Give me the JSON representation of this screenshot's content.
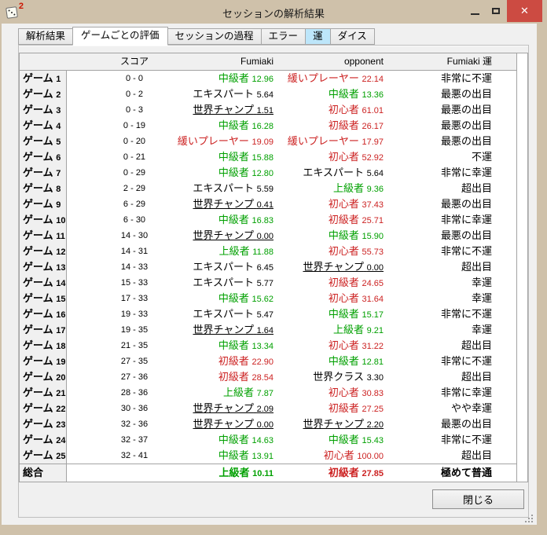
{
  "window": {
    "title": "セッションの解析結果",
    "icon_badge": "2",
    "controls": {
      "close": "✕"
    }
  },
  "tabs": [
    {
      "label": "解析結果",
      "active": false,
      "highlighted": false
    },
    {
      "label": "ゲームごとの評価",
      "active": true,
      "highlighted": false
    },
    {
      "label": "セッションの過程",
      "active": false,
      "highlighted": false
    },
    {
      "label": "エラー",
      "active": false,
      "highlighted": false
    },
    {
      "label": "運",
      "active": false,
      "highlighted": true
    },
    {
      "label": "ダイス",
      "active": false,
      "highlighted": false
    }
  ],
  "table": {
    "headers": {
      "score": "スコア",
      "player1": "Fumiaki",
      "player2": "opponent",
      "luck": "Fumiaki 運"
    },
    "rows": [
      {
        "game": {
          "label": "ゲーム",
          "num": "1"
        },
        "score": "0 - 0",
        "p1": {
          "text": "中級者",
          "num": "12.96",
          "color": "positive",
          "underline": false
        },
        "p2": {
          "text": "緩いプレーヤー",
          "num": "22.14",
          "color": "negative",
          "underline": false
        },
        "luck": "非常に不運"
      },
      {
        "game": {
          "label": "ゲーム",
          "num": "2"
        },
        "score": "0 - 2",
        "p1": {
          "text": "エキスパート",
          "num": "5.64",
          "color": "neutral",
          "underline": false
        },
        "p2": {
          "text": "中級者",
          "num": "13.36",
          "color": "positive",
          "underline": false
        },
        "luck": "最悪の出目"
      },
      {
        "game": {
          "label": "ゲーム",
          "num": "3"
        },
        "score": "0 - 3",
        "p1": {
          "text": "世界チャンプ",
          "num": "1.51",
          "color": "neutral",
          "underline": true
        },
        "p2": {
          "text": "初心者",
          "num": "61.01",
          "color": "negative",
          "underline": false
        },
        "luck": "最悪の出目"
      },
      {
        "game": {
          "label": "ゲーム",
          "num": "4"
        },
        "score": "0 - 19",
        "p1": {
          "text": "中級者",
          "num": "16.28",
          "color": "positive",
          "underline": false
        },
        "p2": {
          "text": "初級者",
          "num": "26.17",
          "color": "negative",
          "underline": false
        },
        "luck": "最悪の出目"
      },
      {
        "game": {
          "label": "ゲーム",
          "num": "5"
        },
        "score": "0 - 20",
        "p1": {
          "text": "緩いプレーヤー",
          "num": "19.09",
          "color": "negative",
          "underline": false
        },
        "p2": {
          "text": "緩いプレーヤー",
          "num": "17.97",
          "color": "negative",
          "underline": false
        },
        "luck": "最悪の出目"
      },
      {
        "game": {
          "label": "ゲーム",
          "num": "6"
        },
        "score": "0 - 21",
        "p1": {
          "text": "中級者",
          "num": "15.88",
          "color": "positive",
          "underline": false
        },
        "p2": {
          "text": "初心者",
          "num": "52.92",
          "color": "negative",
          "underline": false
        },
        "luck": "不運"
      },
      {
        "game": {
          "label": "ゲーム",
          "num": "7"
        },
        "score": "0 - 29",
        "p1": {
          "text": "中級者",
          "num": "12.80",
          "color": "positive",
          "underline": false
        },
        "p2": {
          "text": "エキスパート",
          "num": "5.64",
          "color": "neutral",
          "underline": false
        },
        "luck": "非常に幸運"
      },
      {
        "game": {
          "label": "ゲーム",
          "num": "8"
        },
        "score": "2 - 29",
        "p1": {
          "text": "エキスパート",
          "num": "5.59",
          "color": "neutral",
          "underline": false
        },
        "p2": {
          "text": "上級者",
          "num": "9.36",
          "color": "positive",
          "underline": false
        },
        "luck": "超出目"
      },
      {
        "game": {
          "label": "ゲーム",
          "num": "9"
        },
        "score": "6 - 29",
        "p1": {
          "text": "世界チャンプ",
          "num": "0.41",
          "color": "neutral",
          "underline": true
        },
        "p2": {
          "text": "初心者",
          "num": "37.43",
          "color": "negative",
          "underline": false
        },
        "luck": "最悪の出目"
      },
      {
        "game": {
          "label": "ゲーム",
          "num": "10"
        },
        "score": "6 - 30",
        "p1": {
          "text": "中級者",
          "num": "16.83",
          "color": "positive",
          "underline": false
        },
        "p2": {
          "text": "初級者",
          "num": "25.71",
          "color": "negative",
          "underline": false
        },
        "luck": "非常に幸運"
      },
      {
        "game": {
          "label": "ゲーム",
          "num": "11"
        },
        "score": "14 - 30",
        "p1": {
          "text": "世界チャンプ",
          "num": "0.00",
          "color": "neutral",
          "underline": true
        },
        "p2": {
          "text": "中級者",
          "num": "15.90",
          "color": "positive",
          "underline": false
        },
        "luck": "最悪の出目"
      },
      {
        "game": {
          "label": "ゲーム",
          "num": "12"
        },
        "score": "14 - 31",
        "p1": {
          "text": "上級者",
          "num": "11.88",
          "color": "positive",
          "underline": false
        },
        "p2": {
          "text": "初心者",
          "num": "55.73",
          "color": "negative",
          "underline": false
        },
        "luck": "非常に不運"
      },
      {
        "game": {
          "label": "ゲーム",
          "num": "13"
        },
        "score": "14 - 33",
        "p1": {
          "text": "エキスパート",
          "num": "6.45",
          "color": "neutral",
          "underline": false
        },
        "p2": {
          "text": "世界チャンプ",
          "num": "0.00",
          "color": "neutral",
          "underline": true
        },
        "luck": "超出目"
      },
      {
        "game": {
          "label": "ゲーム",
          "num": "14"
        },
        "score": "15 - 33",
        "p1": {
          "text": "エキスパート",
          "num": "5.77",
          "color": "neutral",
          "underline": false
        },
        "p2": {
          "text": "初級者",
          "num": "24.65",
          "color": "negative",
          "underline": false
        },
        "luck": "幸運"
      },
      {
        "game": {
          "label": "ゲーム",
          "num": "15"
        },
        "score": "17 - 33",
        "p1": {
          "text": "中級者",
          "num": "15.62",
          "color": "positive",
          "underline": false
        },
        "p2": {
          "text": "初心者",
          "num": "31.64",
          "color": "negative",
          "underline": false
        },
        "luck": "幸運"
      },
      {
        "game": {
          "label": "ゲーム",
          "num": "16"
        },
        "score": "19 - 33",
        "p1": {
          "text": "エキスパート",
          "num": "5.47",
          "color": "neutral",
          "underline": false
        },
        "p2": {
          "text": "中級者",
          "num": "15.17",
          "color": "positive",
          "underline": false
        },
        "luck": "非常に不運"
      },
      {
        "game": {
          "label": "ゲーム",
          "num": "17"
        },
        "score": "19 - 35",
        "p1": {
          "text": "世界チャンプ",
          "num": "1.64",
          "color": "neutral",
          "underline": true
        },
        "p2": {
          "text": "上級者",
          "num": "9.21",
          "color": "positive",
          "underline": false
        },
        "luck": "幸運"
      },
      {
        "game": {
          "label": "ゲーム",
          "num": "18"
        },
        "score": "21 - 35",
        "p1": {
          "text": "中級者",
          "num": "13.34",
          "color": "positive",
          "underline": false
        },
        "p2": {
          "text": "初心者",
          "num": "31.22",
          "color": "negative",
          "underline": false
        },
        "luck": "超出目"
      },
      {
        "game": {
          "label": "ゲーム",
          "num": "19"
        },
        "score": "27 - 35",
        "p1": {
          "text": "初級者",
          "num": "22.90",
          "color": "negative",
          "underline": false
        },
        "p2": {
          "text": "中級者",
          "num": "12.81",
          "color": "positive",
          "underline": false
        },
        "luck": "非常に不運"
      },
      {
        "game": {
          "label": "ゲーム",
          "num": "20"
        },
        "score": "27 - 36",
        "p1": {
          "text": "初級者",
          "num": "28.54",
          "color": "negative",
          "underline": false
        },
        "p2": {
          "text": "世界クラス",
          "num": "3.30",
          "color": "neutral",
          "underline": false
        },
        "luck": "超出目"
      },
      {
        "game": {
          "label": "ゲーム",
          "num": "21"
        },
        "score": "28 - 36",
        "p1": {
          "text": "上級者",
          "num": "7.87",
          "color": "positive",
          "underline": false
        },
        "p2": {
          "text": "初心者",
          "num": "30.83",
          "color": "negative",
          "underline": false
        },
        "luck": "非常に幸運"
      },
      {
        "game": {
          "label": "ゲーム",
          "num": "22"
        },
        "score": "30 - 36",
        "p1": {
          "text": "世界チャンプ",
          "num": "2.09",
          "color": "neutral",
          "underline": true
        },
        "p2": {
          "text": "初級者",
          "num": "27.25",
          "color": "negative",
          "underline": false
        },
        "luck": "やや幸運"
      },
      {
        "game": {
          "label": "ゲーム",
          "num": "23"
        },
        "score": "32 - 36",
        "p1": {
          "text": "世界チャンプ",
          "num": "0.00",
          "color": "neutral",
          "underline": true
        },
        "p2": {
          "text": "世界チャンプ",
          "num": "2.20",
          "color": "neutral",
          "underline": true
        },
        "luck": "最悪の出目"
      },
      {
        "game": {
          "label": "ゲーム",
          "num": "24"
        },
        "score": "32 - 37",
        "p1": {
          "text": "中級者",
          "num": "14.63",
          "color": "positive",
          "underline": false
        },
        "p2": {
          "text": "中級者",
          "num": "15.43",
          "color": "positive",
          "underline": false
        },
        "luck": "非常に不運"
      },
      {
        "game": {
          "label": "ゲーム",
          "num": "25"
        },
        "score": "32 - 41",
        "p1": {
          "text": "中級者",
          "num": "13.91",
          "color": "positive",
          "underline": false
        },
        "p2": {
          "text": "初心者",
          "num": "100.00",
          "color": "negative",
          "underline": false
        },
        "luck": "超出目"
      }
    ],
    "total": {
      "label": "総合",
      "p1": {
        "text": "上級者",
        "num": "10.11",
        "color": "positive",
        "underline": false
      },
      "p2": {
        "text": "初級者",
        "num": "27.85",
        "color": "negative",
        "underline": false
      },
      "luck": "極めて普通"
    }
  },
  "footer": {
    "close_label": "閉じる"
  },
  "colors": {
    "positive": "#00a000",
    "negative": "#cc2222",
    "frame": "#cfc1aa",
    "close_button": "#cc4b42",
    "tab_highlight": "#bde6fa"
  }
}
